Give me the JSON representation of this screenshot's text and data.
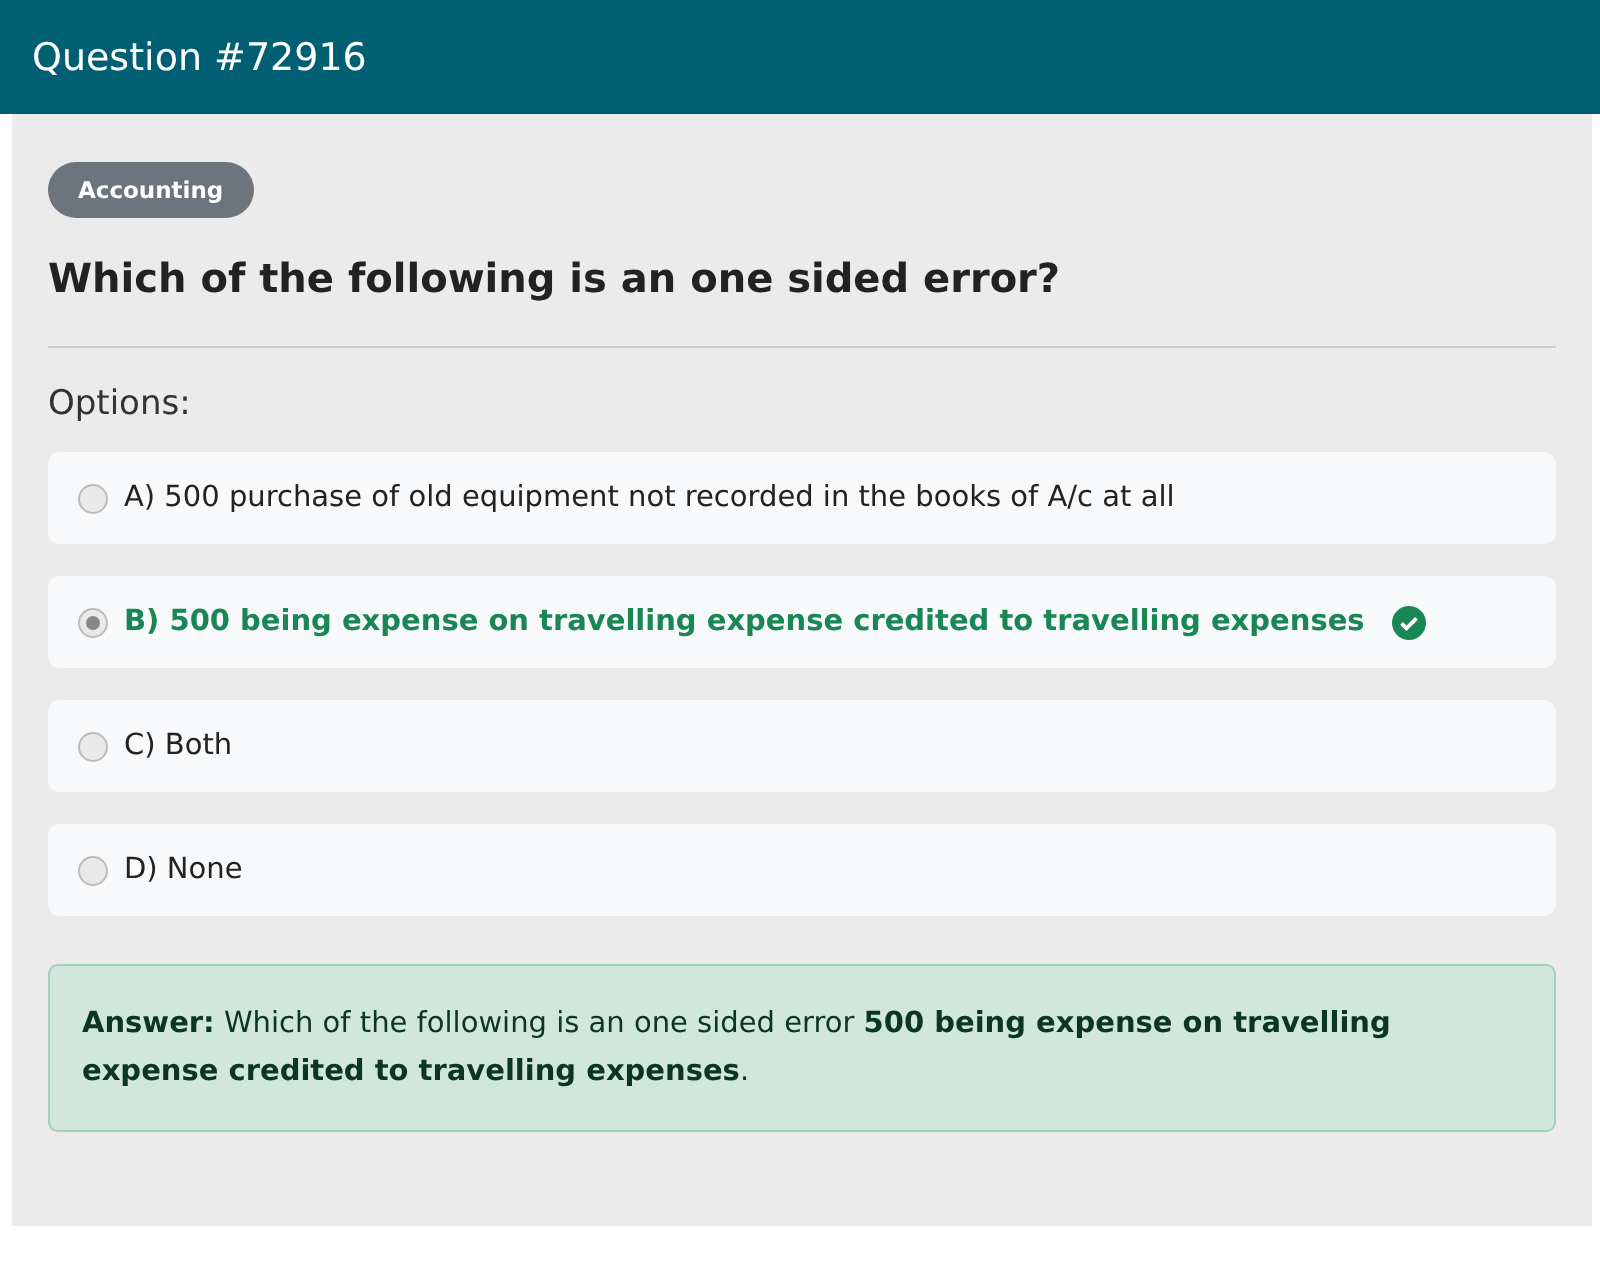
{
  "header": {
    "title": "Question #72916"
  },
  "category": "Accounting",
  "question": "Which of the following is an one sided error?",
  "options_label": "Options:",
  "options": [
    {
      "label": "A) 500 purchase of old equipment not recorded in the books of A/c at all",
      "selected": false,
      "correct": false
    },
    {
      "label": "B) 500 being expense on travelling expense credited to travelling expenses",
      "selected": true,
      "correct": true
    },
    {
      "label": "C) Both",
      "selected": false,
      "correct": false
    },
    {
      "label": "D) None",
      "selected": false,
      "correct": false
    }
  ],
  "answer": "**Answer:** Which of the following is an one sided error **500 being expense on travelling expense credited to travelling expenses**."
}
